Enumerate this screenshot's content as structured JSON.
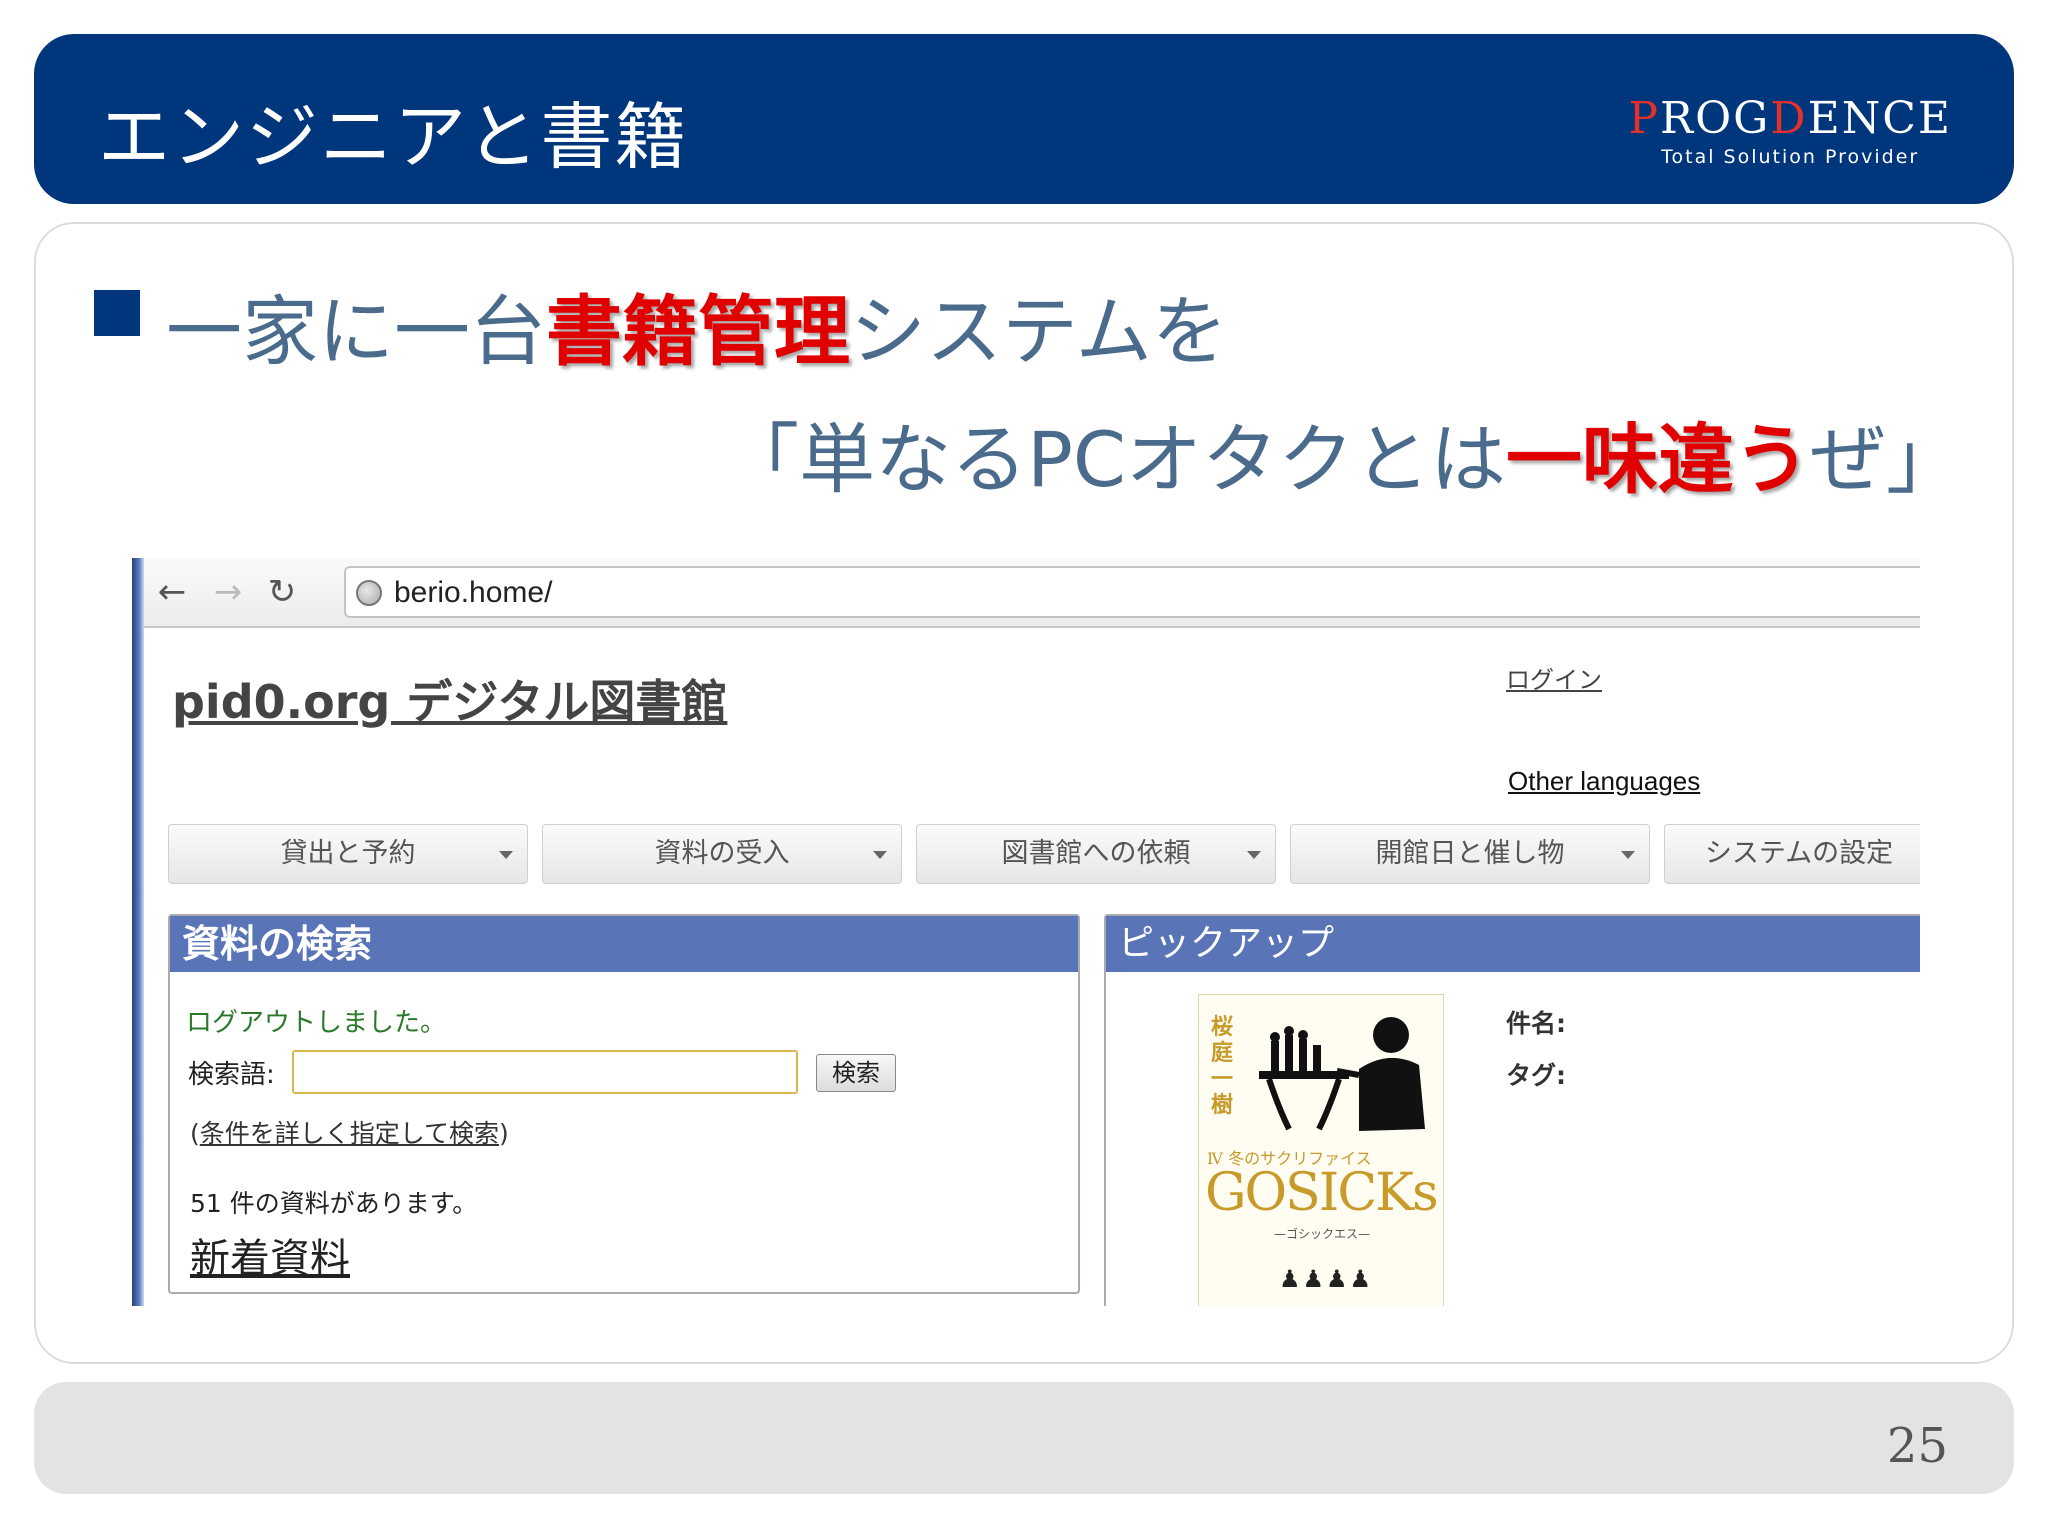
{
  "header": {
    "title": "エンジニアと書籍",
    "logo": {
      "text_pre": "P",
      "text_mid": "ROG",
      "text_accent": "D",
      "text_post": "ENCE",
      "tagline": "Total Solution Provider"
    }
  },
  "bullet": {
    "line1_pre": "一家に一台",
    "line1_hl": "書籍管理",
    "line1_post": "システムを",
    "line2_pre": "「単なるPCオタクとは",
    "line2_hl": "一味違う",
    "line2_post": "ぜ」"
  },
  "browser": {
    "url": "berio.home/",
    "site_title": "pid0.org デジタル図書館",
    "login": "ログイン",
    "other_languages": "Other languages",
    "menu": [
      "貸出と予約",
      "資料の受入",
      "図書館への依頼",
      "開館日と催し物",
      "システムの設定"
    ],
    "search_panel": {
      "title": "資料の検索",
      "logout_message": "ログアウトしました。",
      "label": "検索語:",
      "input_value": "",
      "button": "検索",
      "advanced_open": "(",
      "advanced_link": "条件を詳しく指定して検索",
      "advanced_close": ")",
      "count_text": "51 件の資料があります。",
      "new_items": "新着資料"
    },
    "pickup_panel": {
      "title": "ピックアップ",
      "subject_label": "件名:",
      "tag_label": "タグ:",
      "book": {
        "author": "桜庭一樹",
        "volume": "Ⅳ 冬のサクリファイス",
        "title": "GOSICKs",
        "subtitle": "—ゴシックエス—"
      }
    }
  },
  "footer": {
    "page": "25"
  },
  "colors": {
    "brand": "#00367c",
    "highlight": "#e00000",
    "panel_head": "#5a74b8"
  }
}
